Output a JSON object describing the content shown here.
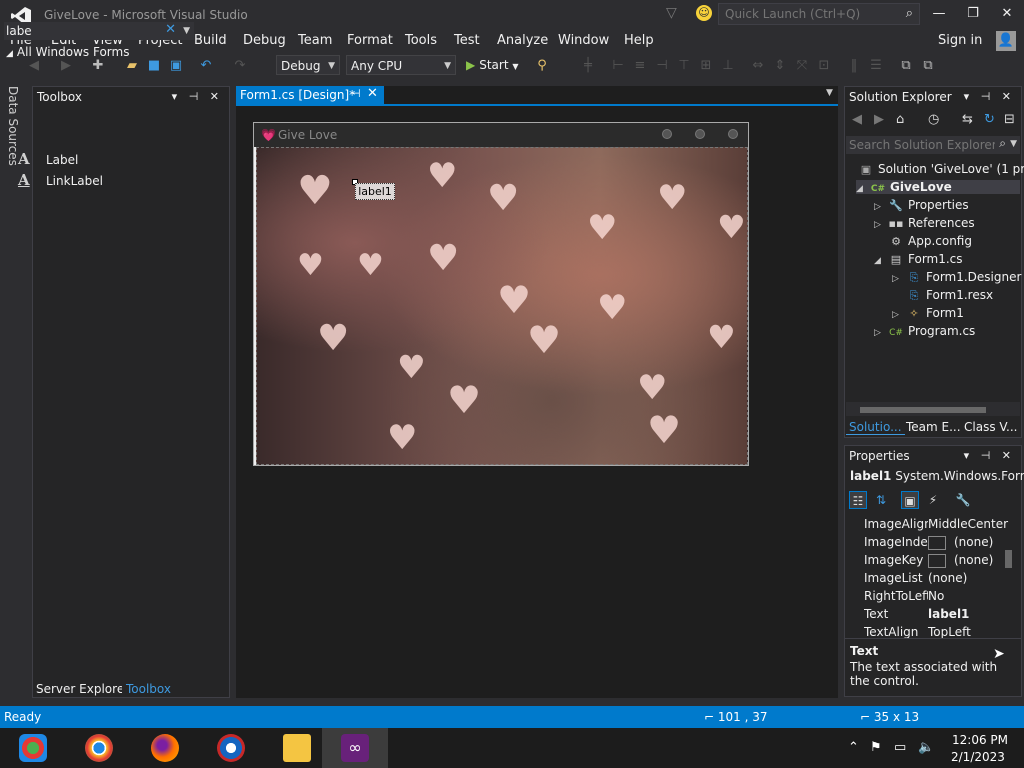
{
  "window": {
    "title": "GiveLove - Microsoft Visual Studio",
    "quick_launch_placeholder": "Quick Launch (Ctrl+Q)"
  },
  "menu": [
    "File",
    "Edit",
    "View",
    "Project",
    "Build",
    "Debug",
    "Team",
    "Format",
    "Tools",
    "Test",
    "Analyze",
    "Window",
    "Help"
  ],
  "account": {
    "sign_in": "Sign in"
  },
  "toolbar": {
    "configuration": "Debug",
    "platform": "Any CPU",
    "start_label": "Start"
  },
  "side_tabs": {
    "data_sources": "Data Sources"
  },
  "toolbox": {
    "title": "Toolbox",
    "search_value": "labe",
    "group": "All Windows Forms",
    "items": [
      {
        "glyph": "A",
        "label": "Label"
      },
      {
        "glyph": "A",
        "label": "LinkLabel"
      }
    ],
    "bottom_tabs": [
      "Server Explorer",
      "Toolbox"
    ]
  },
  "document": {
    "tab_label": "Form1.cs [Design]*"
  },
  "form": {
    "title": "Give Love",
    "label1_text": "label1"
  },
  "solution_explorer": {
    "title": "Solution Explorer",
    "search_placeholder": "Search Solution Explorer",
    "tree": [
      "Solution 'GiveLove' (1 proj",
      "GiveLove",
      "Properties",
      "References",
      "App.config",
      "Form1.cs",
      "Form1.Designer",
      "Form1.resx",
      "Form1",
      "Program.cs"
    ],
    "tabs": [
      "Solutio...",
      "Team E...",
      "Class V..."
    ]
  },
  "properties": {
    "title": "Properties",
    "object_name": "label1",
    "object_type": "System.Windows.Forr",
    "rows": [
      {
        "name": "ImageAlign",
        "value": "MiddleCenter"
      },
      {
        "name": "ImageIndex",
        "value": "(none)"
      },
      {
        "name": "ImageKey",
        "value": "(none)"
      },
      {
        "name": "ImageList",
        "value": "(none)"
      },
      {
        "name": "RightToLeft",
        "value": "No"
      },
      {
        "name": "Text",
        "value": "label1"
      },
      {
        "name": "TextAlign",
        "value": "TopLeft"
      }
    ],
    "description_title": "Text",
    "description_text": "The text associated with the control."
  },
  "status": {
    "text": "Ready",
    "position": "101 , 37",
    "size": "35 x 13"
  },
  "taskbar": {
    "time": "12:06 PM",
    "date": "2/1/2023"
  },
  "colors": {
    "accent": "#007acc",
    "background": "#2d2d30",
    "panel": "#252526",
    "editor": "#1e1e1e"
  },
  "icons": [
    "vs-logo-icon",
    "filter-icon",
    "feedback-smiley-icon",
    "search-icon",
    "minimize-icon",
    "maximize-icon",
    "close-icon",
    "account-icon",
    "play-icon",
    "pin-icon",
    "wrench-icon",
    "references-icon",
    "config-icon",
    "form-icon",
    "csharp-icon",
    "event-lightning-icon",
    "categorized-icon",
    "alphabetical-icon"
  ]
}
